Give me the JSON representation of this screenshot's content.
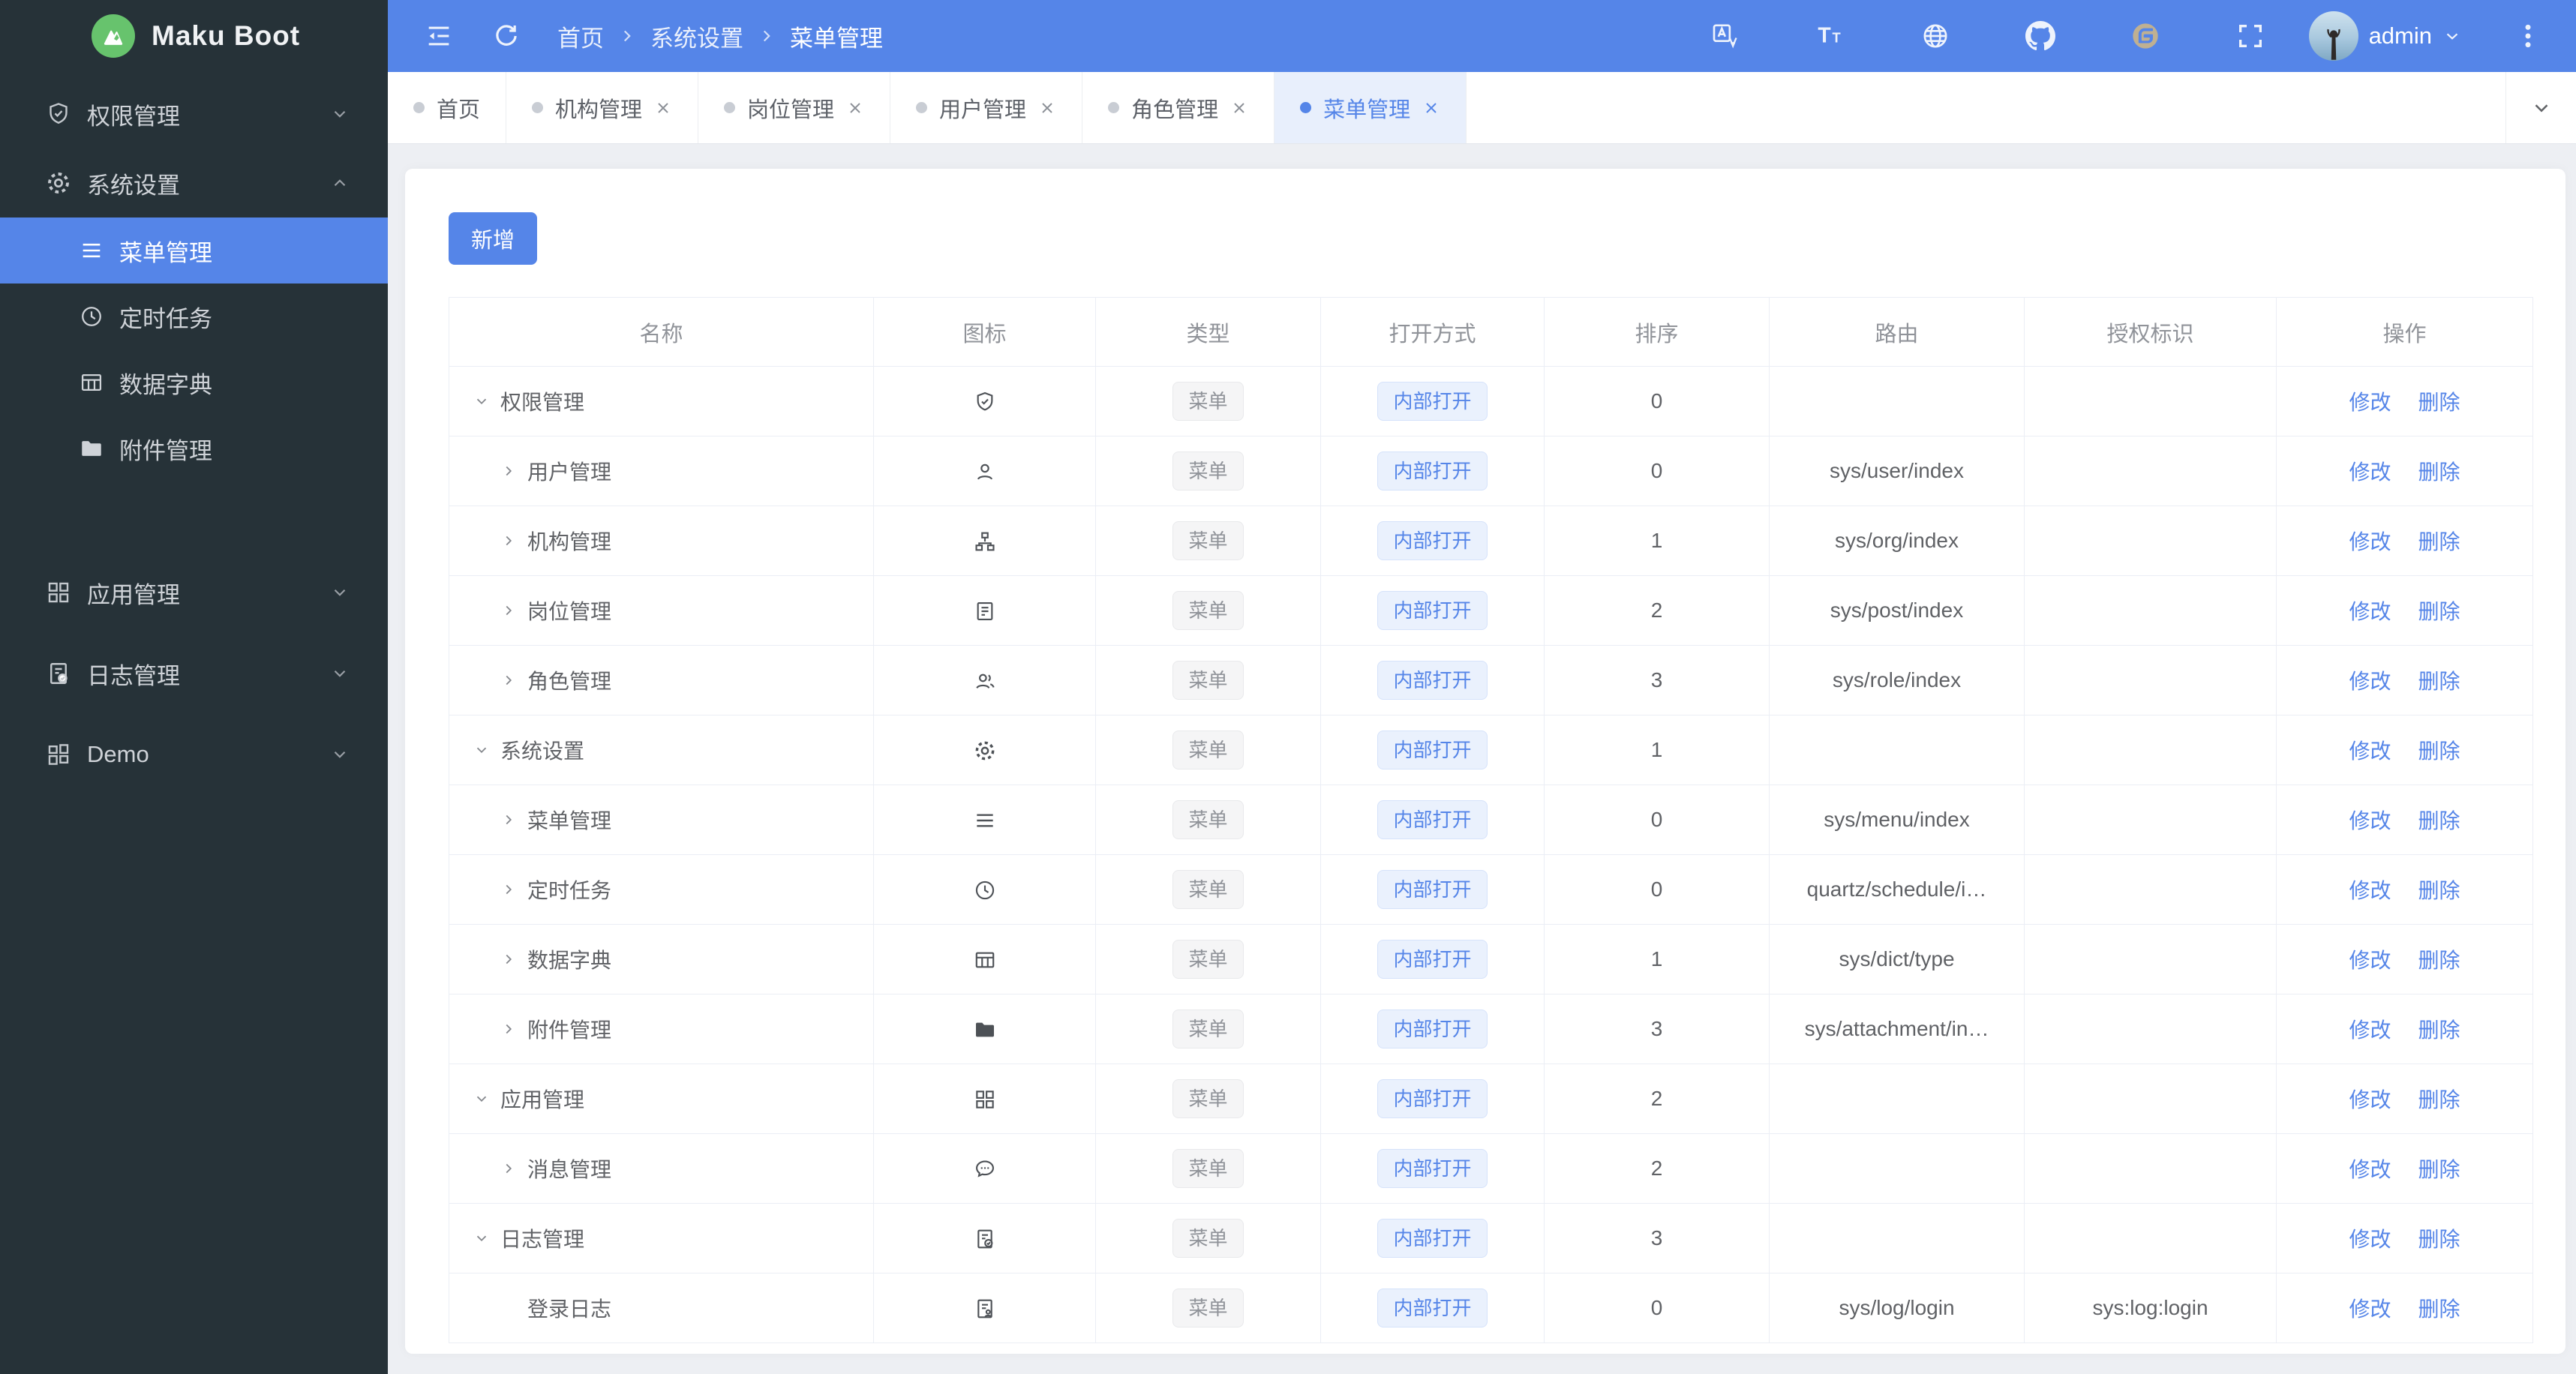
{
  "app": {
    "name": "Maku Boot"
  },
  "theme": {
    "accent": "#5585e8",
    "sidebar_bg": "#263238",
    "active_tab_bg": "#e8effc",
    "content_bg": "#edeff3",
    "link": "#5585e8",
    "logo_green": "#67c36d"
  },
  "navbar": {
    "breadcrumb": [
      {
        "label": "首页"
      },
      {
        "label": "系统设置"
      },
      {
        "label": "菜单管理"
      }
    ],
    "left_icons": [
      {
        "name": "menu-fold-icon"
      },
      {
        "name": "refresh-icon"
      }
    ],
    "right_icons": [
      {
        "name": "translate-icon"
      },
      {
        "name": "font-size-icon"
      },
      {
        "name": "globe-icon"
      },
      {
        "name": "github-icon"
      },
      {
        "name": "gitee-icon"
      },
      {
        "name": "fullscreen-icon"
      }
    ],
    "user": {
      "name": "admin"
    }
  },
  "tabs": [
    {
      "label": "首页",
      "closable": false,
      "active": false
    },
    {
      "label": "机构管理",
      "closable": true,
      "active": false
    },
    {
      "label": "岗位管理",
      "closable": true,
      "active": false
    },
    {
      "label": "用户管理",
      "closable": true,
      "active": false
    },
    {
      "label": "角色管理",
      "closable": true,
      "active": false
    },
    {
      "label": "菜单管理",
      "closable": true,
      "active": true
    }
  ],
  "sidebar": {
    "items": [
      {
        "label": "权限管理",
        "icon": "shield-check-icon",
        "state": "collapsed"
      },
      {
        "label": "系统设置",
        "icon": "gear-icon",
        "state": "expanded",
        "children": [
          {
            "label": "菜单管理",
            "icon": "menu-icon",
            "active": true
          },
          {
            "label": "定时任务",
            "icon": "clock-icon",
            "active": false
          },
          {
            "label": "数据字典",
            "icon": "dict-table-icon",
            "active": false
          },
          {
            "label": "附件管理",
            "icon": "folder-icon",
            "active": false
          }
        ]
      },
      {
        "label": "应用管理",
        "icon": "app-grid-icon",
        "state": "collapsed"
      },
      {
        "label": "日志管理",
        "icon": "log-doc-icon",
        "state": "collapsed"
      },
      {
        "label": "Demo",
        "icon": "demo-grid-icon",
        "state": "collapsed"
      }
    ]
  },
  "page": {
    "add_button": "新增"
  },
  "table": {
    "headers": [
      "名称",
      "图标",
      "类型",
      "打开方式",
      "排序",
      "路由",
      "授权标识",
      "操作"
    ],
    "actions": [
      "修改",
      "删除"
    ],
    "rows": [
      {
        "name": "权限管理",
        "icon": "shield-check-icon",
        "arrow": "down",
        "level": 0,
        "type": "菜单",
        "open": "内部打开",
        "sort": "0",
        "route": "",
        "auth": ""
      },
      {
        "name": "用户管理",
        "icon": "user-icon",
        "arrow": "right",
        "level": 1,
        "type": "菜单",
        "open": "内部打开",
        "sort": "0",
        "route": "sys/user/index",
        "auth": ""
      },
      {
        "name": "机构管理",
        "icon": "org-icon",
        "arrow": "right",
        "level": 1,
        "type": "菜单",
        "open": "内部打开",
        "sort": "1",
        "route": "sys/org/index",
        "auth": ""
      },
      {
        "name": "岗位管理",
        "icon": "post-badge-icon",
        "arrow": "right",
        "level": 1,
        "type": "菜单",
        "open": "内部打开",
        "sort": "2",
        "route": "sys/post/index",
        "auth": ""
      },
      {
        "name": "角色管理",
        "icon": "role-users-icon",
        "arrow": "right",
        "level": 1,
        "type": "菜单",
        "open": "内部打开",
        "sort": "3",
        "route": "sys/role/index",
        "auth": ""
      },
      {
        "name": "系统设置",
        "icon": "gear-icon",
        "arrow": "down",
        "level": 0,
        "type": "菜单",
        "open": "内部打开",
        "sort": "1",
        "route": "",
        "auth": ""
      },
      {
        "name": "菜单管理",
        "icon": "menu-icon",
        "arrow": "right",
        "level": 1,
        "type": "菜单",
        "open": "内部打开",
        "sort": "0",
        "route": "sys/menu/index",
        "auth": ""
      },
      {
        "name": "定时任务",
        "icon": "clock-icon",
        "arrow": "right",
        "level": 1,
        "type": "菜单",
        "open": "内部打开",
        "sort": "0",
        "route": "quartz/schedule/i…",
        "auth": ""
      },
      {
        "name": "数据字典",
        "icon": "dict-table-icon",
        "arrow": "right",
        "level": 1,
        "type": "菜单",
        "open": "内部打开",
        "sort": "1",
        "route": "sys/dict/type",
        "auth": ""
      },
      {
        "name": "附件管理",
        "icon": "folder-icon",
        "arrow": "right",
        "level": 1,
        "type": "菜单",
        "open": "内部打开",
        "sort": "3",
        "route": "sys/attachment/in…",
        "auth": ""
      },
      {
        "name": "应用管理",
        "icon": "app-grid-icon",
        "arrow": "down",
        "level": 0,
        "type": "菜单",
        "open": "内部打开",
        "sort": "2",
        "route": "",
        "auth": ""
      },
      {
        "name": "消息管理",
        "icon": "message-icon",
        "arrow": "right",
        "level": 1,
        "type": "菜单",
        "open": "内部打开",
        "sort": "2",
        "route": "",
        "auth": ""
      },
      {
        "name": "日志管理",
        "icon": "log-doc-icon",
        "arrow": "down",
        "level": 0,
        "type": "菜单",
        "open": "内部打开",
        "sort": "3",
        "route": "",
        "auth": ""
      },
      {
        "name": "登录日志",
        "icon": "login-log-icon",
        "arrow": "none",
        "level": 1,
        "type": "菜单",
        "open": "内部打开",
        "sort": "0",
        "route": "sys/log/login",
        "auth": "sys:log:login"
      }
    ]
  }
}
